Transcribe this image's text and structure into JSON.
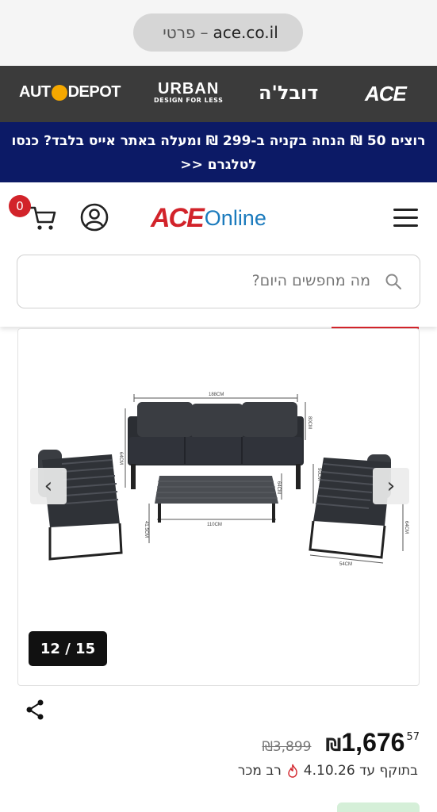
{
  "browser": {
    "url_domain": "ace.co.il",
    "url_sep": "–",
    "url_title": "פרטי"
  },
  "brands": {
    "auto_depot": {
      "pre": "AUT",
      "post": "DEPOT"
    },
    "urban": {
      "name": "URBAN",
      "tagline": "DESIGN FOR LESS"
    },
    "dubal": "דובל'ה",
    "ace": "ACE"
  },
  "promo": {
    "text": "רוצים 50 ₪ הנחה בקניה ב-299 ₪ ומעלה באתר אייס בלבד? כנסו לטלגרם <<"
  },
  "header": {
    "cart_count": "0",
    "logo_ace": "ACE",
    "logo_online": "Online"
  },
  "search": {
    "placeholder": "מה מחפשים היום?"
  },
  "gallery": {
    "counter": "12 / 15",
    "prev_glyph": "‹",
    "next_glyph": "›",
    "dimension_labels": [
      "188CM",
      "64CM",
      "80CM",
      "64CM",
      "110CM",
      "41.5CM",
      "54CM",
      "90CM",
      "64CM",
      "64CM"
    ]
  },
  "price": {
    "main": "1,676",
    "cents": "57",
    "currency": "₪",
    "old": "₪3,899"
  },
  "validity": {
    "text": "בתוקף עד 4.10.26",
    "tag": "רב מכר"
  },
  "colors": {
    "promo_bg": "#0c1a66",
    "ace_red": "#d2232a",
    "online_blue": "#1c7bbd",
    "brand_strip": "#3b3b3b"
  }
}
